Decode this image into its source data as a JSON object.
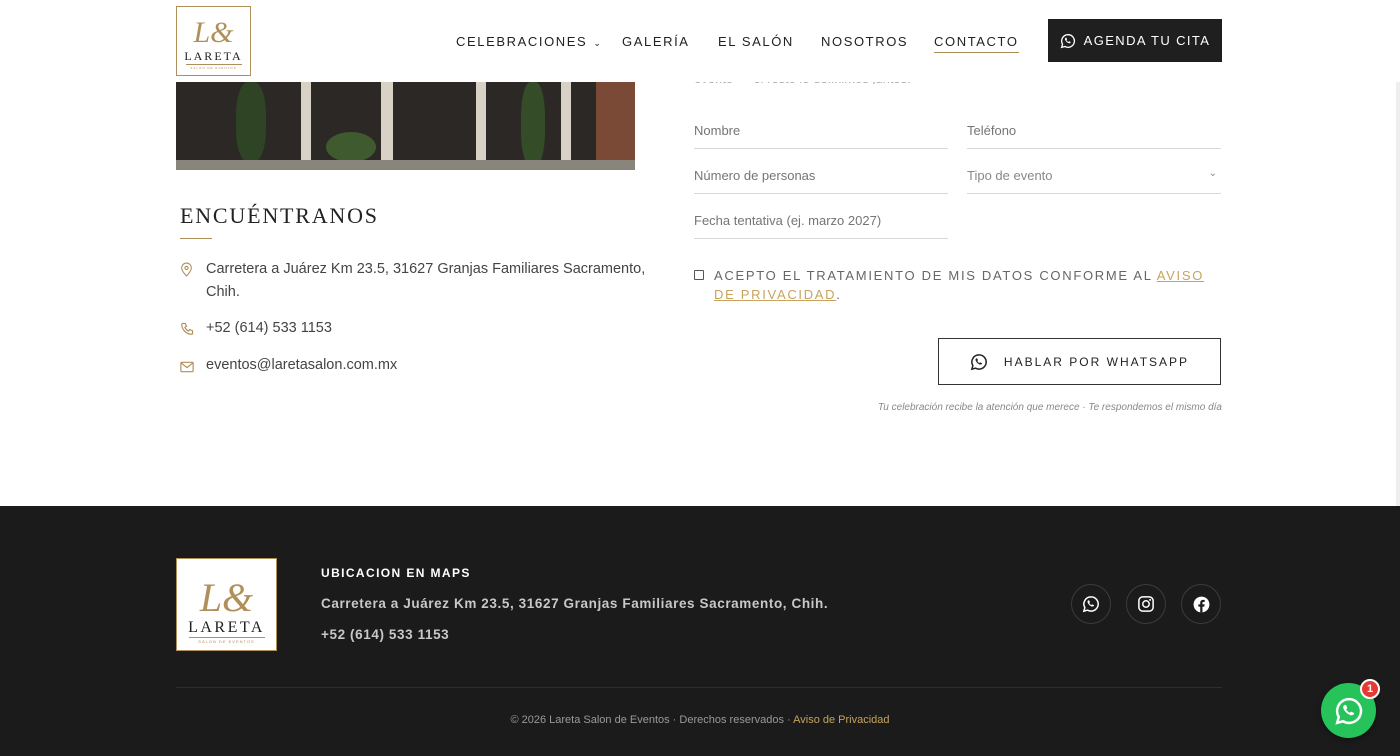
{
  "brand": {
    "logo_word": "LARETA",
    "logo_sub": "SALON DE EVENTOS",
    "logo_mono": "L&"
  },
  "nav": {
    "items": [
      {
        "label": "CELEBRACIONES"
      },
      {
        "label": "GALERÍA"
      },
      {
        "label": "EL SALÓN"
      },
      {
        "label": "NOSOTROS"
      },
      {
        "label": "CONTACTO"
      }
    ],
    "active": "CONTACTO",
    "cta_label": "AGENDA TU CITA"
  },
  "find_us": {
    "title": "ENCUÉNTRANOS",
    "address": "Carretera a Juárez Km 23.5, 31627 Granjas Familiares Sacramento, Chih.",
    "phone": "+52 (614) 533 1153",
    "email": "eventos@laretasalon.com.mx"
  },
  "form": {
    "intro_cut": "evento — el resto lo definimos juntos.",
    "name_placeholder": "Nombre",
    "phone_placeholder": "Teléfono",
    "people_placeholder": "Número de personas",
    "event_type_value": "Tipo de evento",
    "date_placeholder": "Fecha tentativa (ej. marzo 2027)",
    "consent_text": "ACEPTO EL TRATAMIENTO DE MIS DATOS CONFORME AL ",
    "consent_link": "AVISO DE PRIVACIDAD",
    "consent_end": ".",
    "submit_label": "HABLAR POR WHATSAPP",
    "note": "Tu celebración recibe la atención que merece · Te respondemos el mismo día"
  },
  "footer": {
    "heading": "UBICACION EN MAPS",
    "address": "Carretera a Juárez Km 23.5, 31627 Granjas Familiares Sacramento, Chih.",
    "phone": "+52 (614) 533 1153",
    "social": [
      "whatsapp-icon",
      "instagram-icon",
      "facebook-icon"
    ],
    "copyright": "© 2026 Lareta Salon de Eventos · Derechos reservados · ",
    "privacy_link": "Aviso de Privacidad"
  },
  "floating": {
    "badge_count": "1"
  },
  "colors": {
    "accent_gold": "#b08f5a",
    "link_gold": "#c7a35e",
    "dark": "#1b1b1b",
    "whatsapp_green": "#25c35a",
    "badge_red": "#e53935"
  }
}
